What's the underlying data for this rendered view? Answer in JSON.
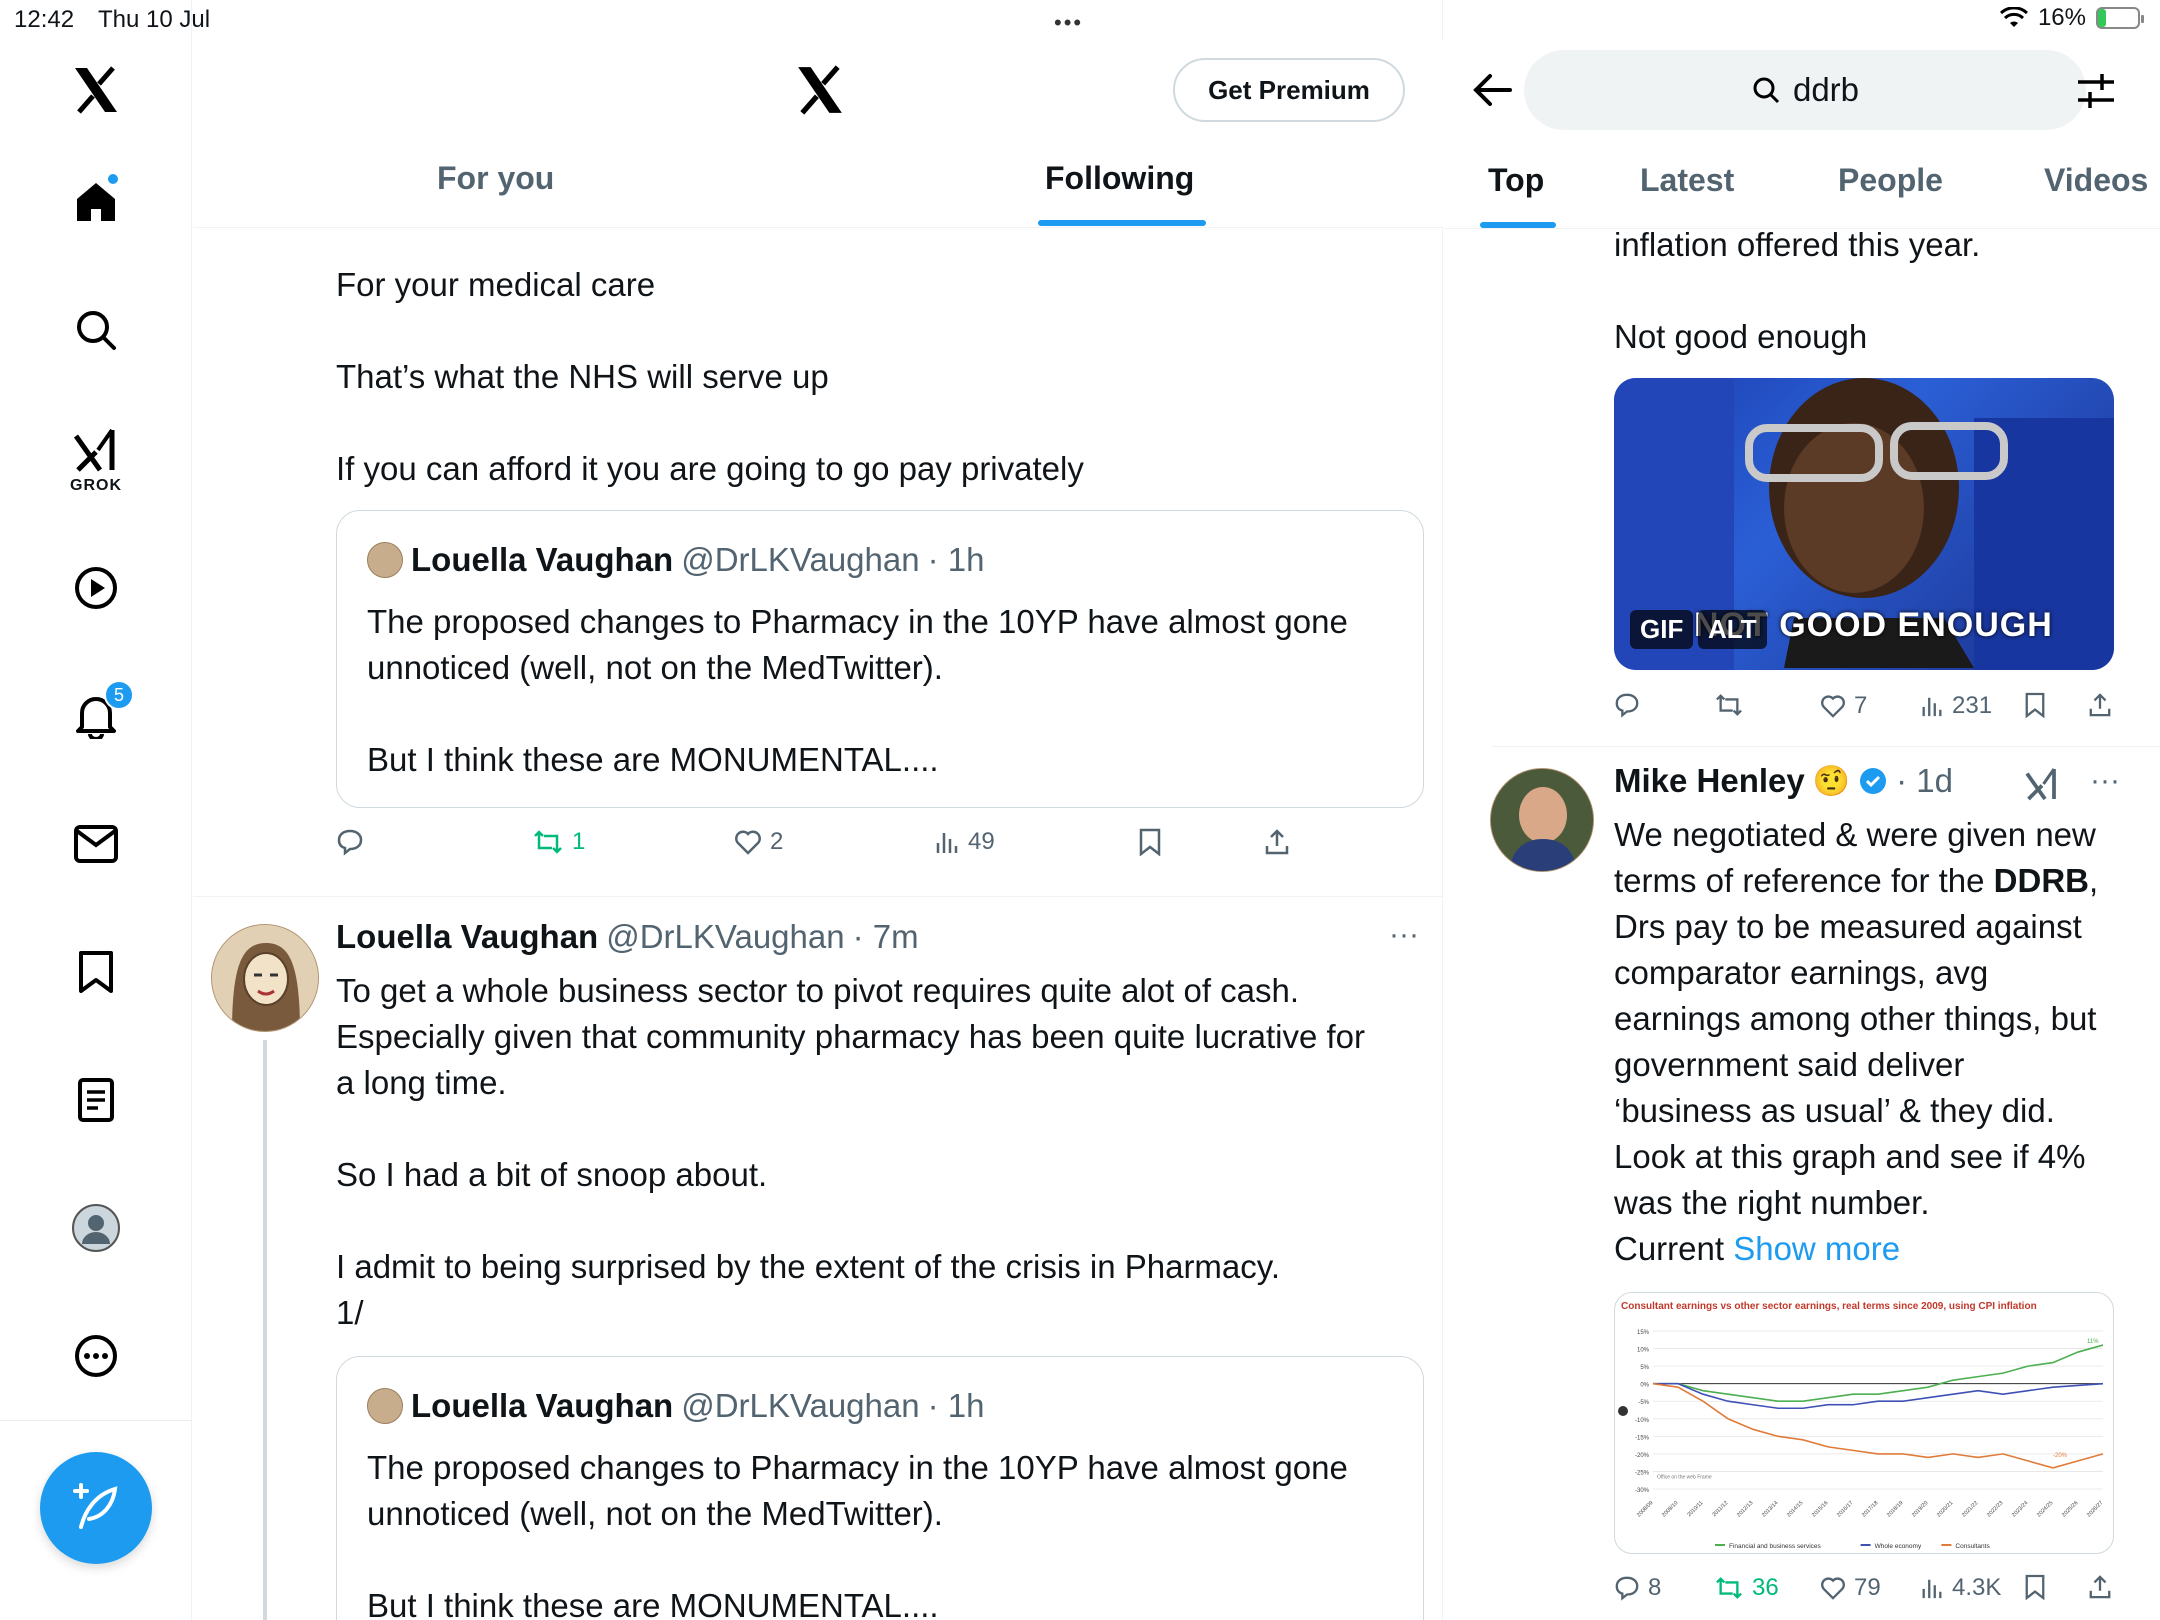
{
  "status_bar": {
    "time": "12:42",
    "date": "Thu 10 Jul",
    "battery": "16%"
  },
  "nav": {
    "grok_label": "GROK",
    "notifications_count": "5"
  },
  "header": {
    "premium_button": "Get Premium",
    "tabs": [
      "For you",
      "Following"
    ]
  },
  "feed": {
    "post1": {
      "lines": [
        "For your medical care",
        "That’s what the NHS will serve up",
        "If you can afford it you are going to go pay privately"
      ],
      "quote": {
        "name": "Louella Vaughan",
        "handle": "@DrLKVaughan",
        "time": "· 1h",
        "line1": "The proposed changes to Pharmacy in the 10YP have almost gone",
        "line2": "unnoticed (well, not on the MedTwitter).",
        "line3": "But I think these are MONUMENTAL...."
      },
      "actions": {
        "reposts": "1",
        "likes": "2",
        "views": "49"
      }
    },
    "post2": {
      "name": "Louella Vaughan",
      "handle": "@DrLKVaughan",
      "time": "· 7m",
      "line1": "To get a whole business sector to pivot requires quite alot of cash.",
      "line2": "Especially given that community pharmacy has been quite lucrative for",
      "line3": "a long time.",
      "line4": "So I had a bit of snoop about.",
      "line5": "I admit to being surprised by the extent of the crisis in Pharmacy.",
      "line6": "1/",
      "quote": {
        "name": "Louella Vaughan",
        "handle": "@DrLKVaughan",
        "time": "· 1h",
        "line1": "The proposed changes to Pharmacy in the 10YP have almost gone",
        "line2": "unnoticed (well, not on the MedTwitter).",
        "line3": "But I think these are MONUMENTAL...."
      }
    }
  },
  "search_panel": {
    "query": "ddrb",
    "tabs": [
      "Top",
      "Latest",
      "People",
      "Videos"
    ],
    "result1": {
      "line1": "inflation offered this year.",
      "line2": "Not good enough",
      "gif_badge": "GIF",
      "alt_badge": "ALT",
      "gif_caption": "NOT GOOD ENOUGH",
      "actions": {
        "likes": "7",
        "views": "231"
      }
    },
    "result2": {
      "name": "Mike Henley",
      "emoji": "🤨",
      "time": "· 1d",
      "lines": [
        "We negotiated & were given new",
        "terms of reference for the ",
        "DDRB",
        ",",
        "Drs pay to be measured against",
        "comparator earnings, avg",
        "earnings among other things, but",
        "government said deliver",
        "‘business as usual’ & they did.",
        "Look at this graph and see if 4%",
        "was the right number.",
        "Current "
      ],
      "show_more": "Show more",
      "chart_title": "Consultant earnings vs other sector earnings, real terms since 2009, using CPI inflation",
      "actions": {
        "replies": "8",
        "reposts": "36",
        "likes": "79",
        "views": "4.3K"
      }
    }
  },
  "chart_data": {
    "type": "line",
    "title": "Consultant earnings vs other sector earnings, real terms since 2009, using CPI inflation",
    "x": [
      "2008/09",
      "2009/10",
      "2010/11",
      "2011/12",
      "2012/13",
      "2013/14",
      "2014/15",
      "2015/16",
      "2016/17",
      "2017/18",
      "2018/19",
      "2019/20",
      "2020/21",
      "2021/22",
      "2022/23",
      "2023/24",
      "2024/25",
      "2025/26",
      "2026/27"
    ],
    "y_ticks": [
      "15%",
      "10%",
      "5%",
      "0%",
      "-5%",
      "-10%",
      "-15%",
      "-20%",
      "-25%",
      "-30%"
    ],
    "ylim": [
      -30,
      15
    ],
    "series": [
      {
        "name": "Financial and business services",
        "color": "#4caf50",
        "values": [
          0,
          0,
          -2,
          -3,
          -4,
          -5,
          -5,
          -4,
          -3,
          -3,
          -2,
          -1,
          1,
          2,
          3,
          5,
          6,
          9,
          11
        ]
      },
      {
        "name": "Whole economy",
        "color": "#3f51b5",
        "values": [
          0,
          0,
          -3,
          -5,
          -6,
          -7,
          -7,
          -6,
          -6,
          -5,
          -5,
          -4,
          -3,
          -2,
          -3,
          -2,
          -1,
          -0.5,
          0
        ]
      },
      {
        "name": "Consultants",
        "color": "#e07b39",
        "values": [
          0,
          -1,
          -5,
          -10,
          -13,
          -15,
          -16,
          -18,
          -19,
          -20,
          -20,
          -21,
          -20,
          -21,
          -20,
          -22,
          -24,
          -22,
          -20
        ]
      }
    ],
    "annotations": [
      "11%",
      "-20%"
    ],
    "source_note": "Office on the web Frame"
  }
}
